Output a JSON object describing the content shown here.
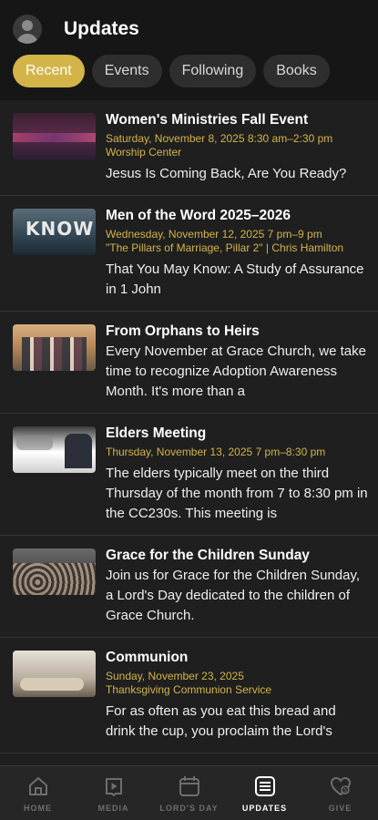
{
  "header": {
    "title": "Updates",
    "tabs": [
      {
        "label": "Recent",
        "active": true
      },
      {
        "label": "Events",
        "active": false
      },
      {
        "label": "Following",
        "active": false
      },
      {
        "label": "Books",
        "active": false
      }
    ]
  },
  "feed": [
    {
      "title": "Women's Ministries Fall Event",
      "meta": "Saturday, November 8, 2025 8:30 am–2:30 pm",
      "meta2": "Worship Center",
      "desc": "Jesus Is Coming Back, Are You Ready?"
    },
    {
      "title": "Men of the Word 2025–2026",
      "meta": "Wednesday, November 12, 2025 7 pm–9 pm",
      "meta2": "\"The Pillars of Marriage, Pillar 2\" | Chris Hamilton",
      "desc": "That You May Know: A Study of Assurance in 1 John",
      "thumb_text": "KNOW"
    },
    {
      "title": "From Orphans to Heirs",
      "desc": "Every November at Grace Church, we take time to recognize Adoption Awareness Month. It's more than a"
    },
    {
      "title": "Elders Meeting",
      "meta": "Thursday, November 13, 2025 7 pm–8:30 pm",
      "desc": "The elders typically meet on the third Thursday of the month from 7 to 8:30 pm in the CC230s. This meeting is"
    },
    {
      "title": "Grace for the Children Sunday",
      "desc": "Join us for Grace for the Children Sunday, a Lord's Day dedicated to the children of Grace Church."
    },
    {
      "title": "Communion",
      "meta": "Sunday, November 23, 2025",
      "meta2": "Thanksgiving Communion Service",
      "desc": "For as often as you eat this bread and drink the cup, you proclaim the Lord's"
    }
  ],
  "bottom_nav": [
    {
      "label": "HOME",
      "icon": "home-icon",
      "active": false
    },
    {
      "label": "MEDIA",
      "icon": "media-icon",
      "active": false
    },
    {
      "label": "LORD'S DAY",
      "icon": "calendar-icon",
      "active": false
    },
    {
      "label": "UPDATES",
      "icon": "updates-icon",
      "active": true
    },
    {
      "label": "GIVE",
      "icon": "give-icon",
      "active": false
    }
  ],
  "colors": {
    "accent": "#d2b449",
    "background": "#161616",
    "card": "#1f1f1f"
  }
}
